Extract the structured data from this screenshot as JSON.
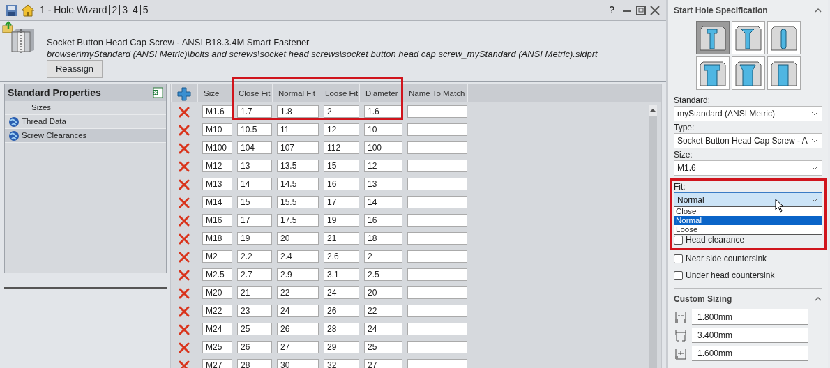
{
  "window": {
    "tabs": [
      {
        "label": "1 - Hole Wizard"
      },
      {
        "label": "2"
      },
      {
        "label": "3"
      },
      {
        "label": "4"
      },
      {
        "label": "5"
      }
    ],
    "controls": [
      "?"
    ]
  },
  "fastener": {
    "title": "Socket Button Head Cap Screw - ANSI B18.3.4M Smart Fastener",
    "path": "browser\\myStandard (ANSI Metric)\\bolts and screws\\socket head screws\\socket button head cap screw_myStandard (ANSI Metric).sldprt",
    "button": "Reassign"
  },
  "properties": {
    "title": "Standard Properties",
    "items": [
      {
        "label": "Sizes",
        "kind": "plain",
        "selected": false
      },
      {
        "label": "Thread Data",
        "kind": "globe",
        "selected": false
      },
      {
        "label": "Screw Clearances",
        "kind": "globe",
        "selected": true
      }
    ]
  },
  "grid": {
    "columns": [
      "Size",
      "Close Fit",
      "Normal Fit",
      "Loose Fit",
      "Diameter",
      "Name To Match"
    ],
    "rows": [
      [
        "M1.6",
        "1.7",
        "1.8",
        "2",
        "1.6"
      ],
      [
        "M10",
        "10.5",
        "11",
        "12",
        "10"
      ],
      [
        "M100",
        "104",
        "107",
        "112",
        "100"
      ],
      [
        "M12",
        "13",
        "13.5",
        "15",
        "12"
      ],
      [
        "M13",
        "14",
        "14.5",
        "16",
        "13"
      ],
      [
        "M14",
        "15",
        "15.5",
        "17",
        "14"
      ],
      [
        "M16",
        "17",
        "17.5",
        "19",
        "16"
      ],
      [
        "M18",
        "19",
        "20",
        "21",
        "18"
      ],
      [
        "M2",
        "2.2",
        "2.4",
        "2.6",
        "2"
      ],
      [
        "M2.5",
        "2.7",
        "2.9",
        "3.1",
        "2.5"
      ],
      [
        "M20",
        "21",
        "22",
        "24",
        "20"
      ],
      [
        "M22",
        "23",
        "24",
        "26",
        "22"
      ],
      [
        "M24",
        "25",
        "26",
        "28",
        "24"
      ],
      [
        "M25",
        "26",
        "27",
        "29",
        "25"
      ],
      [
        "M27",
        "28",
        "30",
        "32",
        "27"
      ]
    ]
  },
  "panel": {
    "title": "Start Hole Specification",
    "hole_types": [
      {
        "selected": true
      },
      {
        "selected": false
      },
      {
        "selected": false
      },
      {
        "selected": false
      },
      {
        "selected": false
      },
      {
        "selected": false
      }
    ],
    "selects": [
      {
        "label": "Standard:",
        "value": "myStandard (ANSI Metric)"
      },
      {
        "label": "Type:",
        "value": "Socket Button Head Cap Screw - A"
      },
      {
        "label": "Size:",
        "value": "M1.6"
      }
    ],
    "fit": {
      "label": "Fit:",
      "value": "Normal",
      "expanded": true,
      "options": [
        {
          "label": "Close",
          "selected": false
        },
        {
          "label": "Normal",
          "selected": true
        },
        {
          "label": "Loose",
          "selected": false
        }
      ]
    },
    "checkboxes": [
      {
        "label": "Head clearance",
        "checked": false
      },
      {
        "label": "Near side countersink",
        "checked": false
      },
      {
        "label": "Under head countersink",
        "checked": false
      }
    ],
    "custom_sizing": {
      "title": "Custom Sizing",
      "fields": [
        "1.800mm",
        "3.400mm",
        "1.600mm"
      ]
    }
  }
}
